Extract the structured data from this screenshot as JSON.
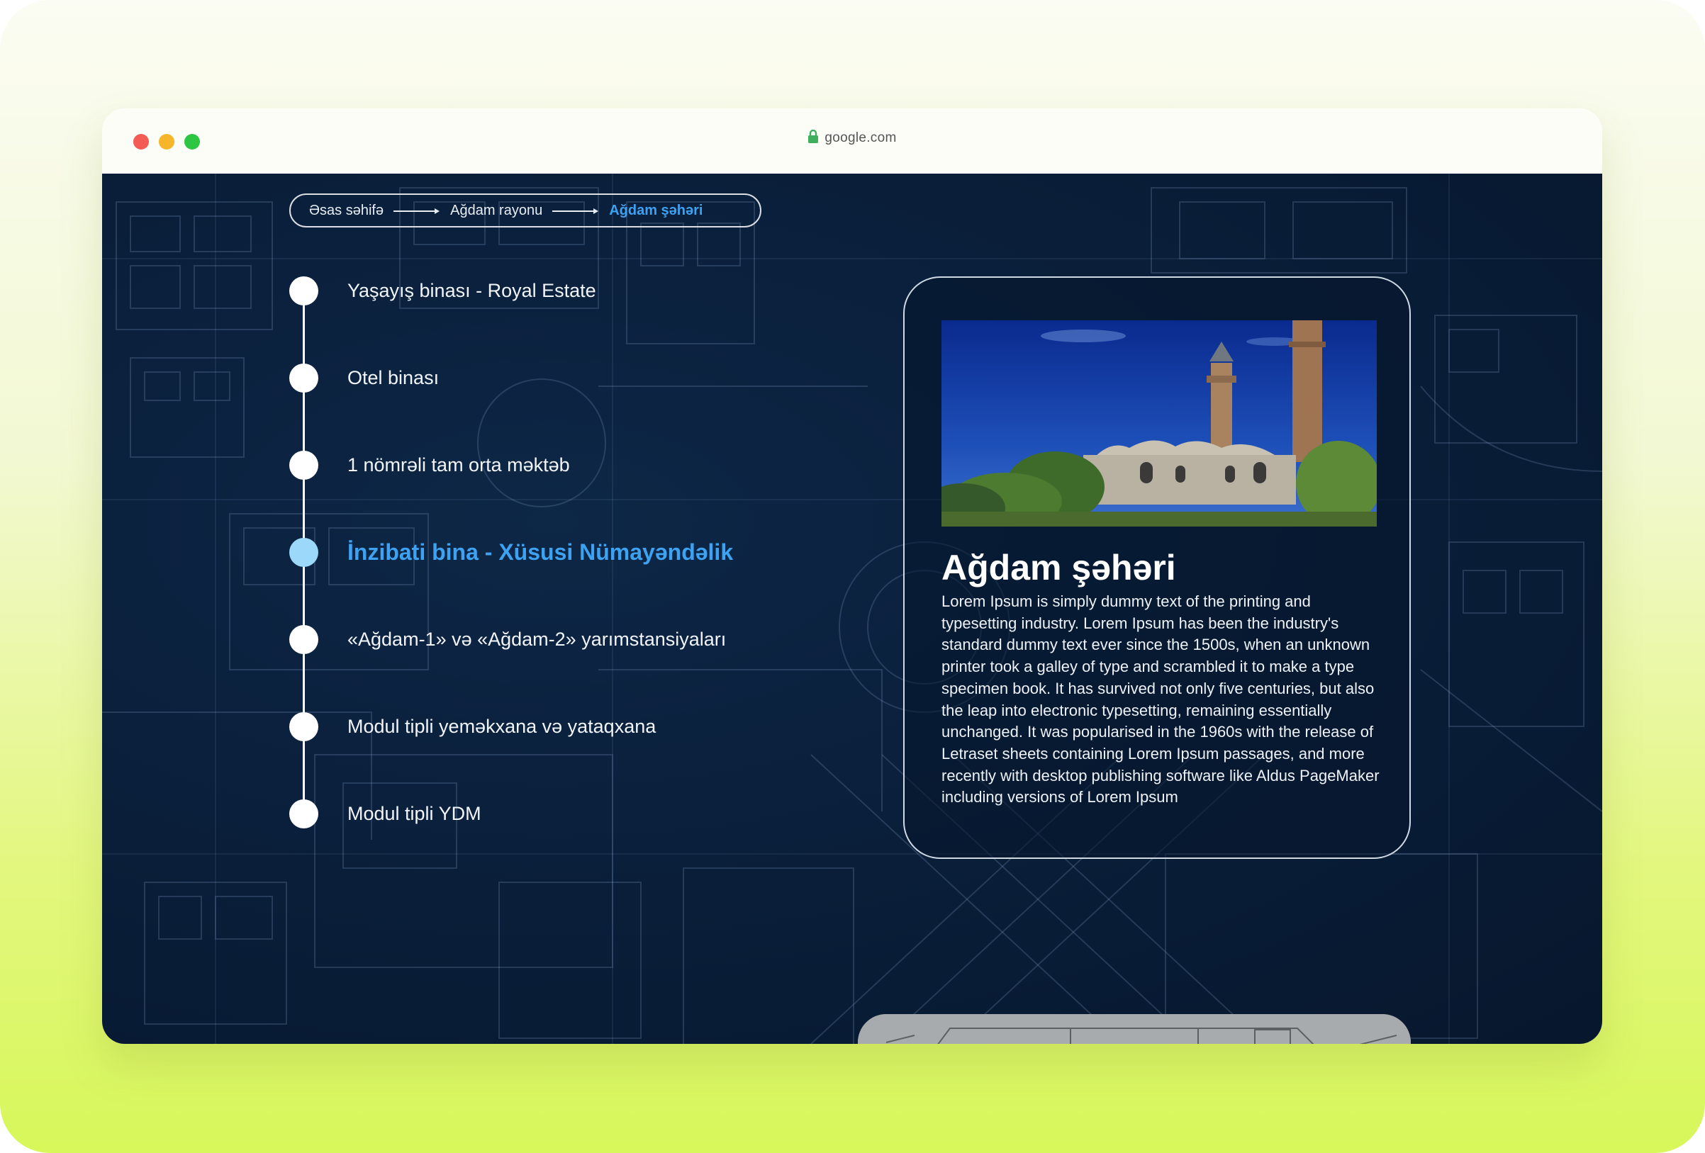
{
  "browser": {
    "url": "google.com"
  },
  "breadcrumb": [
    {
      "label": "Əsas səhifə",
      "active": false
    },
    {
      "label": "Ağdam rayonu",
      "active": false
    },
    {
      "label": "Ağdam şəhəri",
      "active": true
    }
  ],
  "timeline": {
    "items": [
      {
        "label": "Yaşayış binası - Royal Estate",
        "active": false
      },
      {
        "label": "Otel binası",
        "active": false
      },
      {
        "label": "1 nömrəli tam orta məktəb",
        "active": false
      },
      {
        "label": "İnzibati bina - Xüsusi Nümayəndəlik",
        "active": true
      },
      {
        "label": "«Ağdam-1» və «Ağdam-2» yarımstansiyaları",
        "active": false
      },
      {
        "label": "Modul tipli yeməkxana və yataqxana",
        "active": false
      },
      {
        "label": "Modul tipli YDM",
        "active": false
      }
    ]
  },
  "card": {
    "title": "Ağdam şəhəri",
    "description": "Lorem Ipsum is simply dummy text of the printing and typesetting industry. Lorem Ipsum has been the industry's standard dummy text ever since the 1500s, when an unknown printer took a galley of type and scrambled it to make a type specimen book. It has survived not only five centuries, but also the leap into electronic typesetting, remaining essentially unchanged. It was popularised in the 1960s with the release of Letraset sheets containing Lorem Ipsum passages, and more recently with desktop publishing software like Aldus PageMaker including versions of Lorem Ipsum"
  },
  "colors": {
    "accent": "#3ea2f2",
    "active_dot": "#9cd8f9",
    "background": "#0a1f3b"
  },
  "icons": [
    "lock-icon",
    "arrow-right-icon"
  ]
}
